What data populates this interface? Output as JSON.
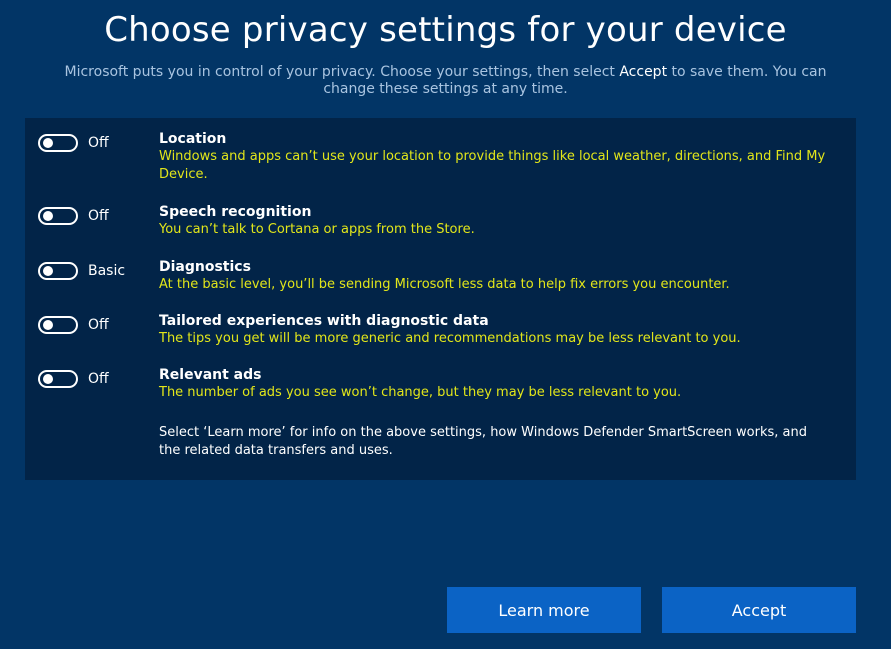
{
  "header": {
    "title": "Choose privacy settings for your device",
    "subtitle_before": "Microsoft puts you in control of your privacy.  Choose your settings, then select ",
    "subtitle_em": "Accept",
    "subtitle_after": " to save them. You can change these settings at any time."
  },
  "settings": [
    {
      "state": "Off",
      "title": "Location",
      "description": "Windows and apps can’t use your location to provide things like local weather, directions, and Find My Device."
    },
    {
      "state": "Off",
      "title": "Speech recognition",
      "description": "You can’t talk to Cortana or apps from the Store."
    },
    {
      "state": "Basic",
      "title": "Diagnostics",
      "description": "At the basic level, you’ll be sending Microsoft less data to help fix errors you encounter."
    },
    {
      "state": "Off",
      "title": "Tailored experiences with diagnostic data",
      "description": "The tips you get will be more generic and recommendations may be less relevant to you."
    },
    {
      "state": "Off",
      "title": "Relevant ads",
      "description": "The number of ads you see won’t change, but they may be less relevant to you."
    }
  ],
  "note": "Select ‘Learn more’ for info on the above settings, how Windows Defender SmartScreen works, and the related data transfers and uses.",
  "buttons": {
    "learn_more": "Learn more",
    "accept": "Accept"
  },
  "colors": {
    "background": "#023566",
    "panel": "#022448",
    "description_text": "#e2e61a",
    "button": "#0b63c5"
  }
}
